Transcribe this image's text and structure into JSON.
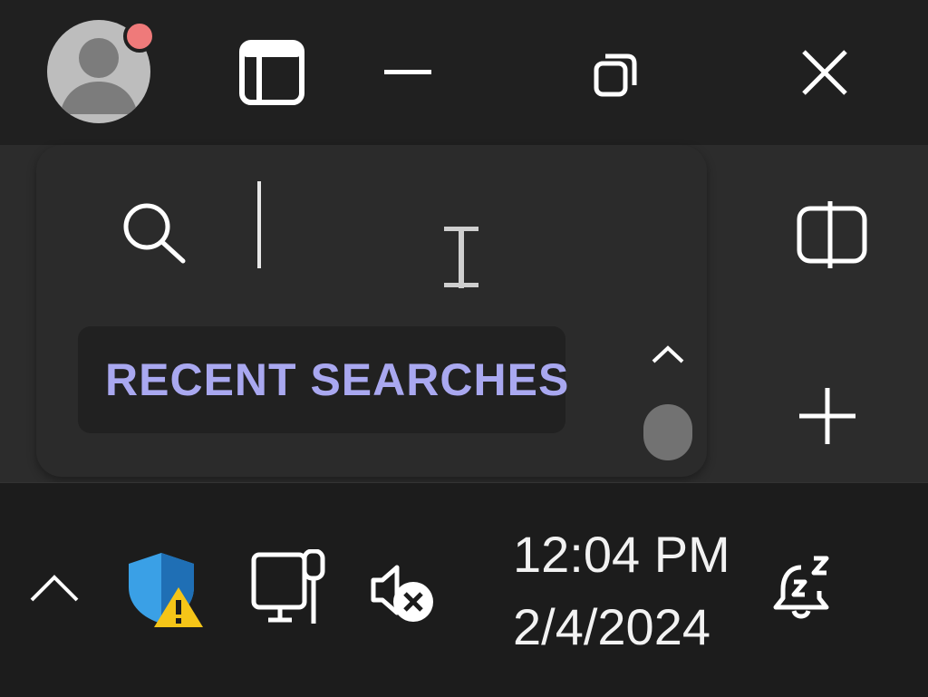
{
  "titlebar": {
    "buttons": {
      "pane": "Toggle sidebar",
      "minimize": "Minimize",
      "restore": "Restore",
      "close": "Close"
    }
  },
  "search": {
    "recent_label": "RECENT SEARCHES",
    "input_value": ""
  },
  "side_actions": {
    "split": "Split view",
    "add": "Add"
  },
  "taskbar": {
    "time": "12:04 PM",
    "date": "2/4/2024"
  },
  "colors": {
    "accent": "#a9a8f0",
    "notification_badge": "#ef7a7a",
    "warning": "#f5c518",
    "shield": "#3aa0e6"
  }
}
